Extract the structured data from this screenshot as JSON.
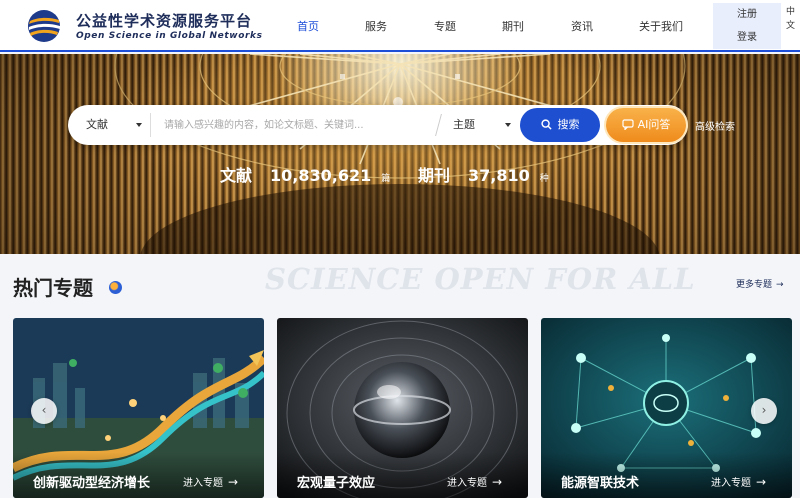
{
  "header": {
    "brand_cn": "公益性学术资源服务平台",
    "brand_en": "Open Science in Global Networks",
    "nav": [
      "首页",
      "服务",
      "专题",
      "期刊",
      "资讯",
      "关于我们"
    ],
    "active_nav": "首页",
    "auth": {
      "register": "注册",
      "login": "登录"
    },
    "lang_label": "中文"
  },
  "search": {
    "type_select": "文献",
    "placeholder": "请输入感兴趣的内容，如论文标题、关键词...",
    "field_select": "主题",
    "search_button": "搜索",
    "ai_button": "AI问答",
    "advanced_link": "高级检索"
  },
  "stats": [
    {
      "label": "文献",
      "value": "10,830,621",
      "unit": "篇"
    },
    {
      "label": "期刊",
      "value": "37,810",
      "unit": "种"
    }
  ],
  "section": {
    "title": "热门专题",
    "slogan": "SCIENCE OPEN FOR ALL",
    "more_link": "更多专题"
  },
  "cards": [
    {
      "title": "创新驱动型经济增长",
      "enter": "进入专题"
    },
    {
      "title": "宏观量子效应",
      "enter": "进入专题"
    },
    {
      "title": "能源智联技术",
      "enter": "进入专题"
    }
  ],
  "colors": {
    "primary": "#1e4fd0",
    "ai_orange": "#ef8b1c",
    "brand_dark": "#1e2d5a"
  },
  "icons": {
    "logo": "logo-globe-icon",
    "search": "search-icon",
    "ai": "ai-chat-icon",
    "more_arrow": "arrow-right-icon",
    "prev": "chevron-left-icon",
    "next": "chevron-right-icon"
  }
}
